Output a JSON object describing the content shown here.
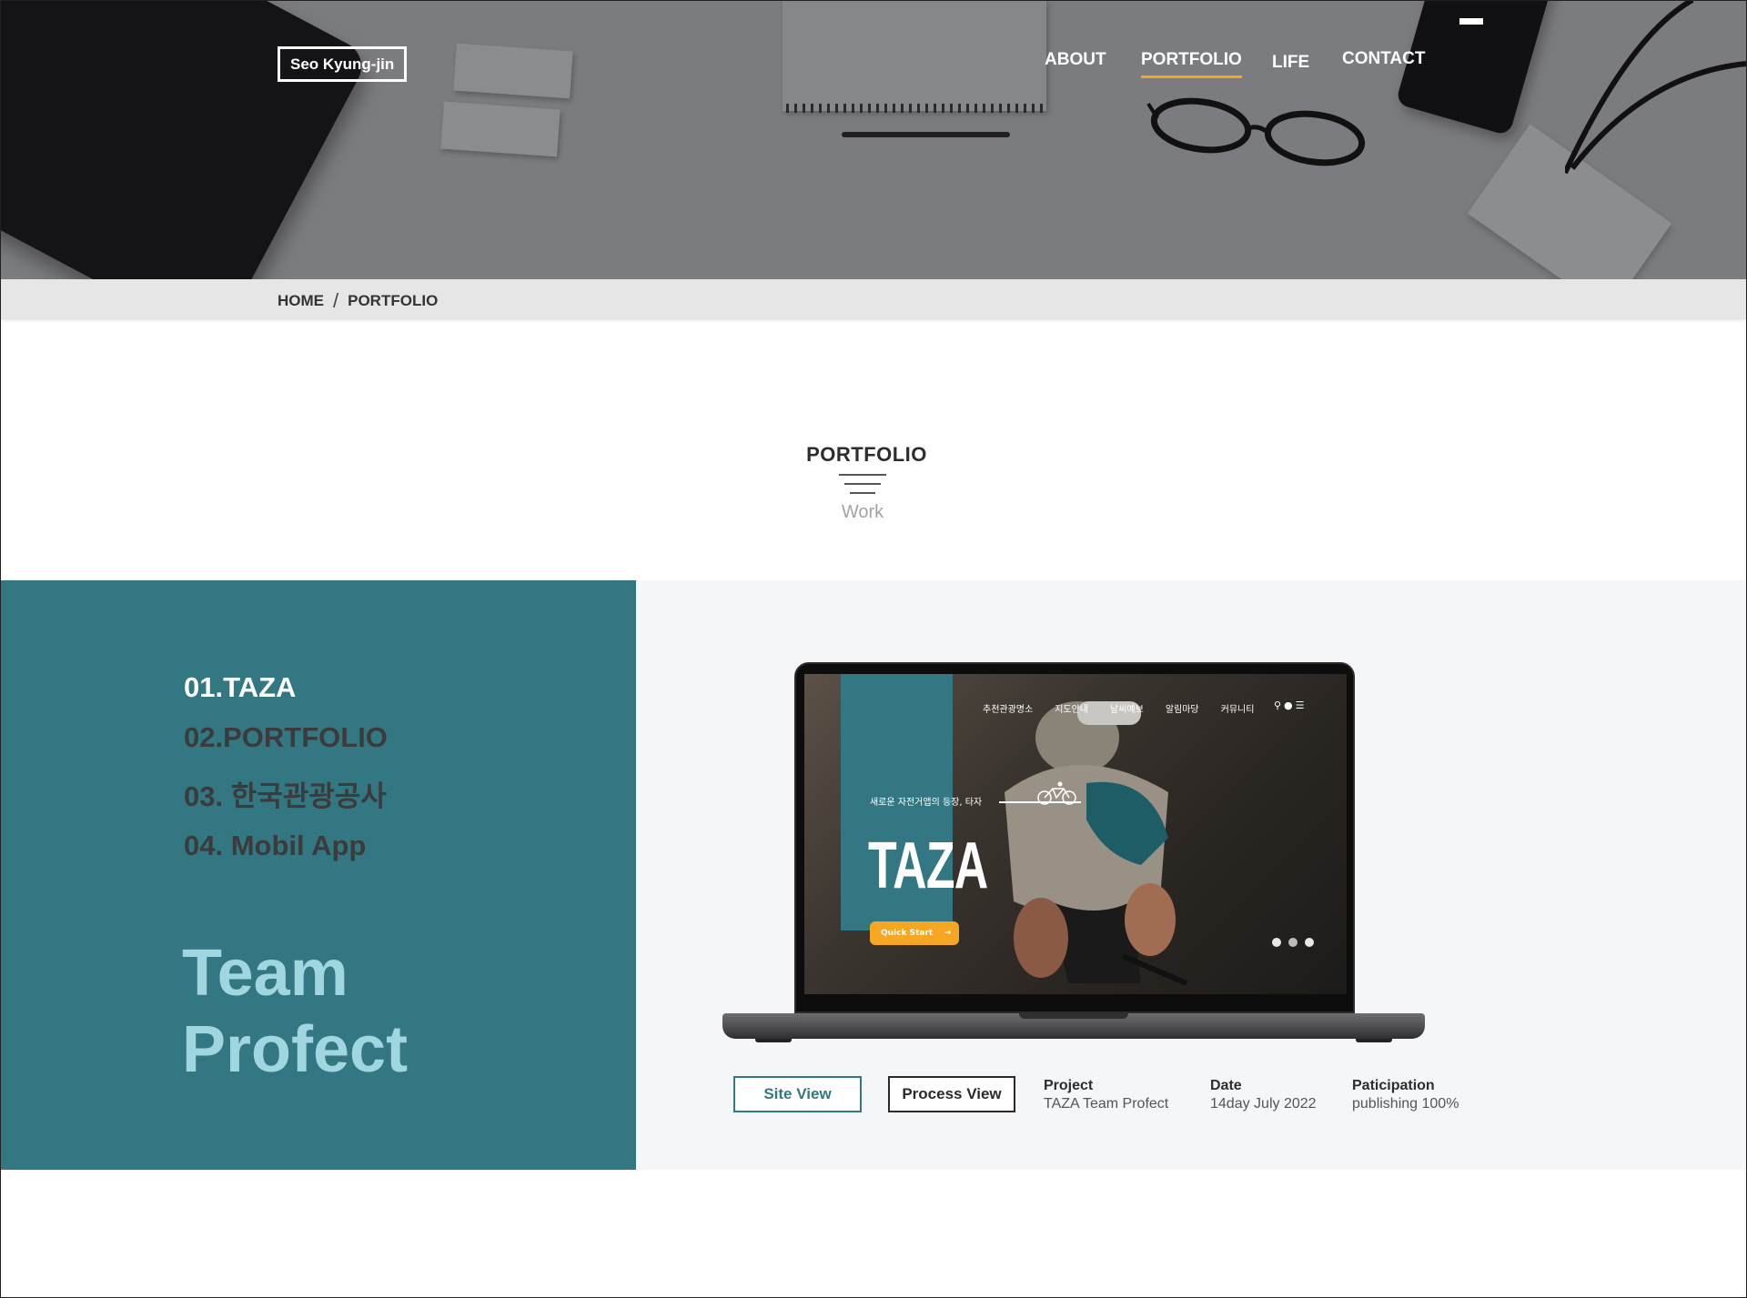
{
  "header": {
    "logo": "Seo Kyung-jin",
    "nav": [
      {
        "label": "ABOUT",
        "active": false
      },
      {
        "label": "PORTFOLIO",
        "active": true
      },
      {
        "label": "LIFE",
        "active": false
      },
      {
        "label": "CONTACT",
        "active": false
      }
    ],
    "accent_color": "#f5a623",
    "menu_icon": "menu-toggle-icon"
  },
  "breadcrumb": {
    "home": "HOME",
    "separator": "/",
    "current": "PORTFOLIO"
  },
  "section": {
    "title": "PORTFOLIO",
    "subtitle": "Work"
  },
  "portfolio": {
    "panel_color": "#337783",
    "projects": [
      {
        "label": "01.TAZA",
        "active": true
      },
      {
        "label": "02.PORTFOLIO",
        "active": false
      },
      {
        "label": "03. 한국관광공사",
        "active": false
      },
      {
        "label": "04. Mobil App",
        "active": false
      }
    ],
    "team_title_line1": "Team",
    "team_title_line2": "Profect",
    "preview": {
      "nav": [
        "추천관광명소",
        "지도안내",
        "날씨예보",
        "알림마당",
        "커뮤니티"
      ],
      "tagline": "새로운 자전거앱의 등장, 타자",
      "brand": "TAZA",
      "cta": "Quick Start",
      "cta_arrow": "→"
    },
    "buttons": {
      "site_view": "Site View",
      "process_view": "Process View"
    },
    "meta": [
      {
        "label": "Project",
        "value": "TAZA Team Profect"
      },
      {
        "label": "Date",
        "value": "14day July 2022"
      },
      {
        "label": "Paticipation",
        "value": "publishing 100%"
      }
    ]
  }
}
